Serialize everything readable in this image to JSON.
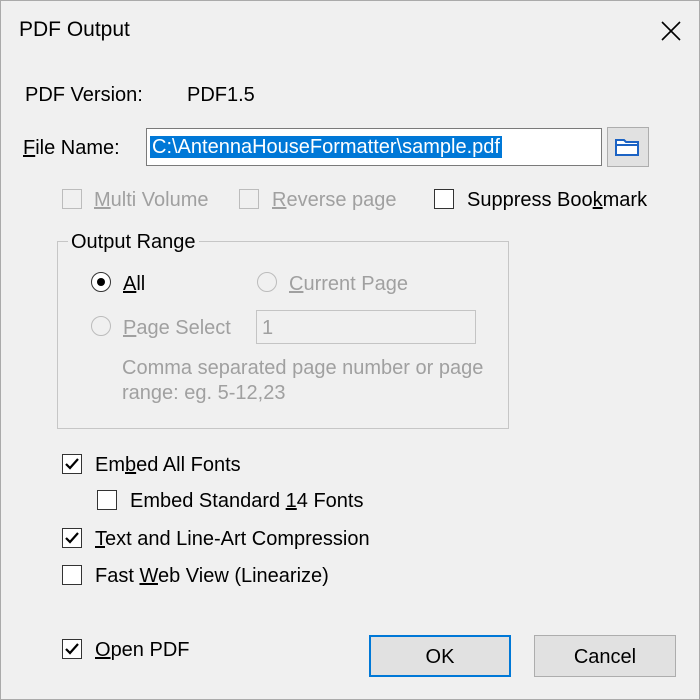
{
  "window": {
    "title": "PDF Output"
  },
  "pdf_version": {
    "label": "PDF Version:",
    "value": "PDF1.5"
  },
  "file_name": {
    "label_mnemonic": "F",
    "label_rest": "ile Name:",
    "value": "C:\\AntennaHouseFormatter\\sample.pdf"
  },
  "options": {
    "multi_volume": {
      "mnemonic": "M",
      "rest": "ulti Volume",
      "checked": false,
      "enabled": false
    },
    "reverse_page": {
      "mnemonic": "R",
      "rest": "everse page",
      "checked": false,
      "enabled": false
    },
    "suppress_bookmark": {
      "before": "Suppress Boo",
      "mnemonic": "k",
      "after": "mark",
      "checked": false,
      "enabled": true
    }
  },
  "output_range": {
    "legend": "Output Range",
    "all": {
      "mnemonic": "A",
      "rest": "ll",
      "selected": true
    },
    "current_page": {
      "mnemonic": "C",
      "rest": "urrent Page",
      "selected": false,
      "enabled": false
    },
    "page_select": {
      "mnemonic": "P",
      "rest": "age Select",
      "selected": false,
      "enabled": false,
      "value": "1"
    },
    "hint_line1": "Comma separated page number or page",
    "hint_line2": "range: eg. 5-12,23"
  },
  "fonts": {
    "embed_all": {
      "before": "Em",
      "mnemonic": "b",
      "after": "ed All Fonts",
      "checked": true
    },
    "embed_standard": {
      "before": "Embed Standard ",
      "mnemonic": "1",
      "after": "4 Fonts",
      "checked": false
    }
  },
  "compression": {
    "mnemonic": "T",
    "rest": "ext and Line-Art Compression",
    "checked": true
  },
  "fast_web": {
    "before": "Fast ",
    "mnemonic": "W",
    "after": "eb View (Linearize)",
    "checked": false
  },
  "open_pdf": {
    "mnemonic": "O",
    "rest": "pen PDF",
    "checked": true
  },
  "buttons": {
    "ok": "OK",
    "cancel": "Cancel"
  },
  "icons": {
    "close": "close-icon",
    "browse": "folder-icon",
    "check": "checkmark-icon"
  },
  "colors": {
    "selection": "#0078d7",
    "folder": "#1c63c4",
    "disabled_text": "#a0a0a0"
  }
}
